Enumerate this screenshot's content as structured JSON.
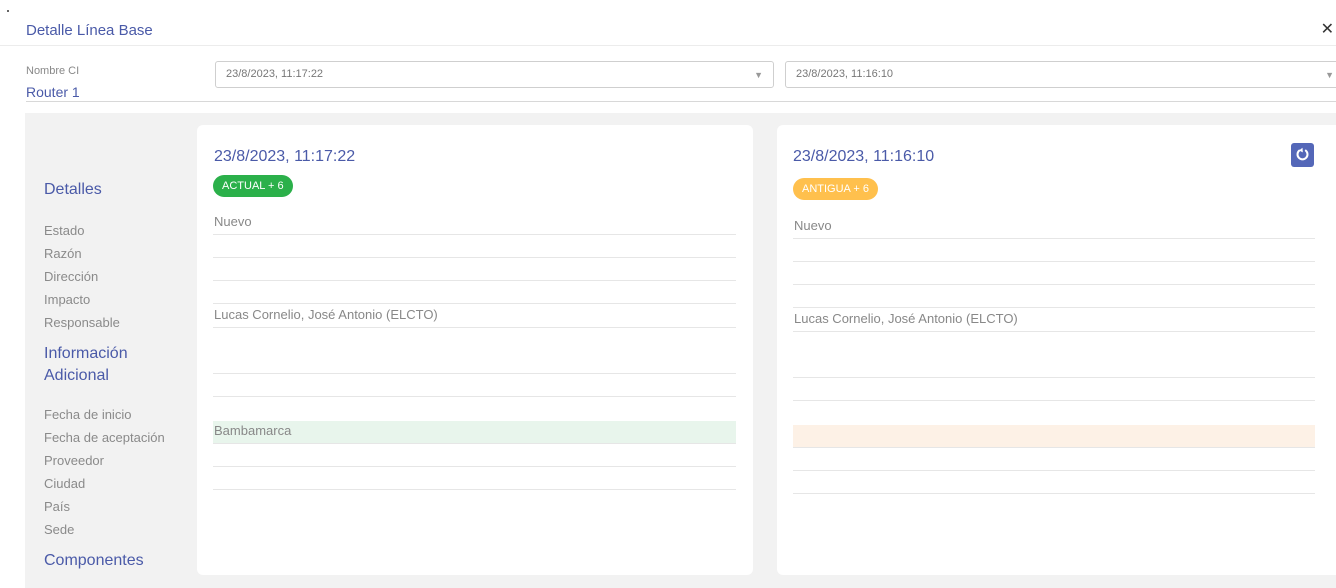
{
  "header": {
    "title": "Detalle Línea Base",
    "close_glyph": "✕"
  },
  "ci": {
    "label": "Nombre CI",
    "value": "Router 1"
  },
  "selects": {
    "left": {
      "value": "23/8/2023, 11:17:22",
      "caret": "▼"
    },
    "right": {
      "value": "23/8/2023, 11:16:10",
      "caret": "▼"
    }
  },
  "sidebar": {
    "details_heading": "Detalles",
    "details_fields": [
      "Estado",
      "Razón",
      "Dirección",
      "Impacto",
      "Responsable"
    ],
    "additional_heading_line1": "Información",
    "additional_heading_line2": "Adicional",
    "additional_fields": [
      "Fecha de inicio",
      "Fecha de aceptación",
      "Proveedor",
      "Ciudad",
      "País",
      "Sede"
    ],
    "components_heading": "Componentes"
  },
  "card_left": {
    "date": "23/8/2023, 11:17:22",
    "badge": "ACTUAL + 6",
    "values": {
      "estado": "Nuevo",
      "razon": "",
      "direccion": "",
      "impacto": "",
      "responsable": "Lucas Cornelio, José Antonio (ELCTO)",
      "fecha_inicio": "",
      "fecha_aceptacion": "",
      "proveedor": "",
      "ciudad": "Bambamarca",
      "pais": "",
      "sede": ""
    }
  },
  "card_right": {
    "date": "23/8/2023, 11:16:10",
    "badge": "ANTIGUA + 6",
    "values": {
      "estado": "Nuevo",
      "razon": "",
      "direccion": "",
      "impacto": "",
      "responsable": "Lucas Cornelio, José Antonio (ELCTO)",
      "fecha_inicio": "",
      "fecha_aceptacion": "",
      "proveedor": "",
      "ciudad": "",
      "pais": "",
      "sede": ""
    }
  },
  "colors": {
    "accent": "#4a5aa8",
    "actual_badge": "#2bb04a",
    "antigua_badge": "#ffc04d",
    "changed_new": "#e8f5ec",
    "changed_old": "#fdf1e6"
  },
  "icons": {
    "close": "close-icon",
    "dropdown": "chevron-down-icon",
    "refresh": "refresh-icon"
  }
}
